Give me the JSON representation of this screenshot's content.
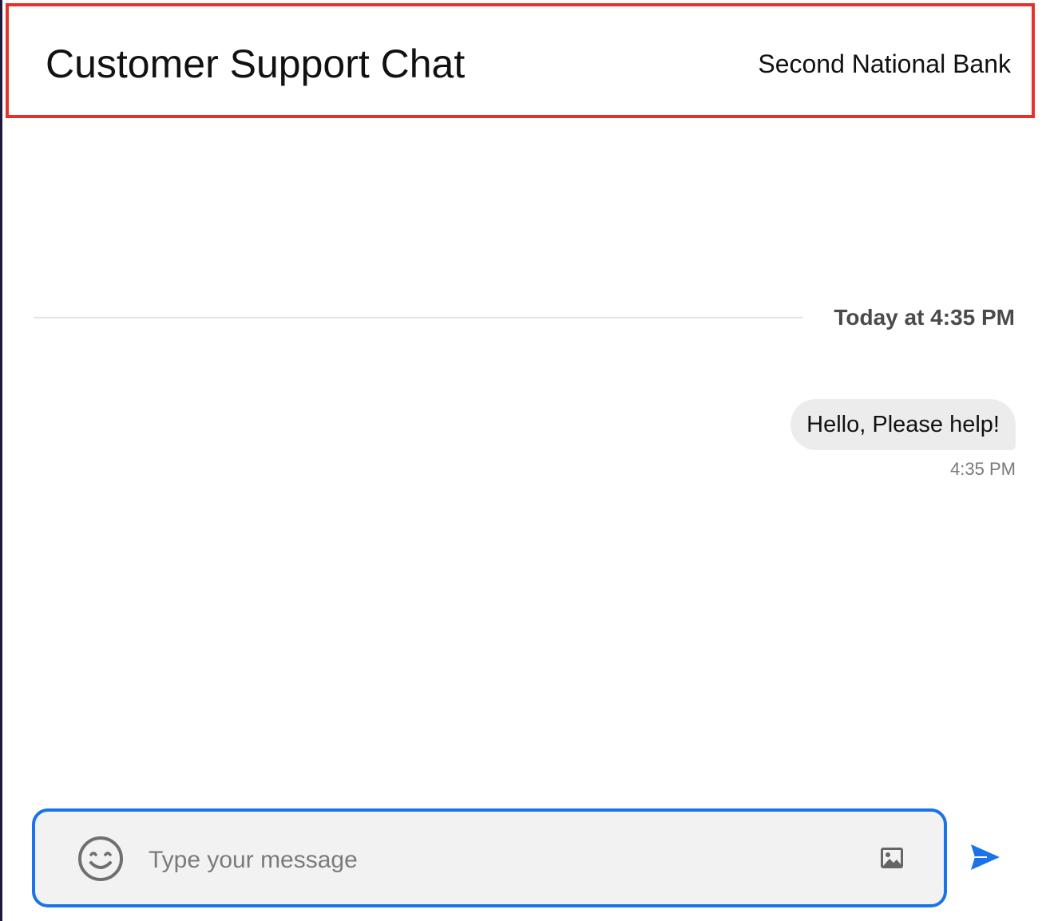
{
  "header": {
    "title": "Customer Support Chat",
    "brand": "Second National Bank"
  },
  "conversation": {
    "date_divider": "Today at 4:35 PM",
    "messages": [
      {
        "text": "Hello, Please help!",
        "time": "4:35 PM",
        "sender": "user"
      }
    ]
  },
  "composer": {
    "placeholder": "Type your message",
    "value": "",
    "emoji_icon": "smile-icon",
    "image_icon": "image-icon",
    "send_icon": "send-icon"
  },
  "colors": {
    "header_border": "#e8302a",
    "accent": "#1a73e8",
    "bubble_bg": "#ececec",
    "composer_bg": "#f2f2f2"
  }
}
